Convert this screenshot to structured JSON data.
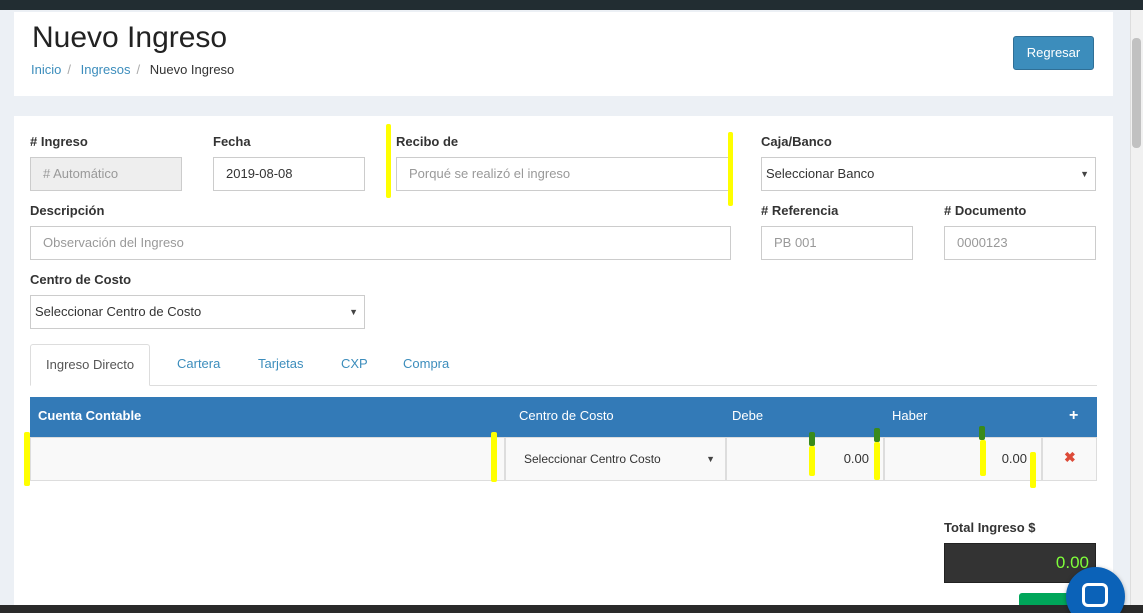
{
  "header": {
    "title": "Nuevo Ingreso",
    "breadcrumb": [
      "Inicio",
      "Ingresos",
      "Nuevo Ingreso"
    ],
    "back_button": "Regresar"
  },
  "form": {
    "ingreso": {
      "label": "# Ingreso",
      "value": "# Automático"
    },
    "fecha": {
      "label": "Fecha",
      "value": "2019-08-08"
    },
    "recibo": {
      "label": "Recibo de",
      "placeholder": "Porqué se realizó el ingreso"
    },
    "caja": {
      "label": "Caja/Banco",
      "value": "Seleccionar Banco"
    },
    "descripcion": {
      "label": "Descripción",
      "placeholder": "Observación del Ingreso"
    },
    "referencia": {
      "label": "# Referencia",
      "placeholder": "PB 001"
    },
    "documento": {
      "label": "# Documento",
      "placeholder": "0000123"
    },
    "centro": {
      "label": "Centro de Costo",
      "value": "Seleccionar Centro de Costo"
    }
  },
  "tabs": [
    "Ingreso Directo",
    "Cartera",
    "Tarjetas",
    "CXP",
    "Compra"
  ],
  "table": {
    "headers": [
      "Cuenta Contable",
      "Centro de Costo",
      "Debe",
      "Haber"
    ],
    "add_icon": "plus-icon",
    "row": {
      "centro": "Seleccionar Centro Costo",
      "debe": "0.00",
      "haber": "0.00",
      "delete_icon": "close-icon"
    }
  },
  "total": {
    "label": "Total Ingreso $",
    "value": "0.00"
  },
  "colors": {
    "primary": "#3c8dbc",
    "table_header": "#337ab7",
    "delete": "#dd4b39",
    "total_text": "#7fff3a",
    "highlight": "#ffff00"
  }
}
